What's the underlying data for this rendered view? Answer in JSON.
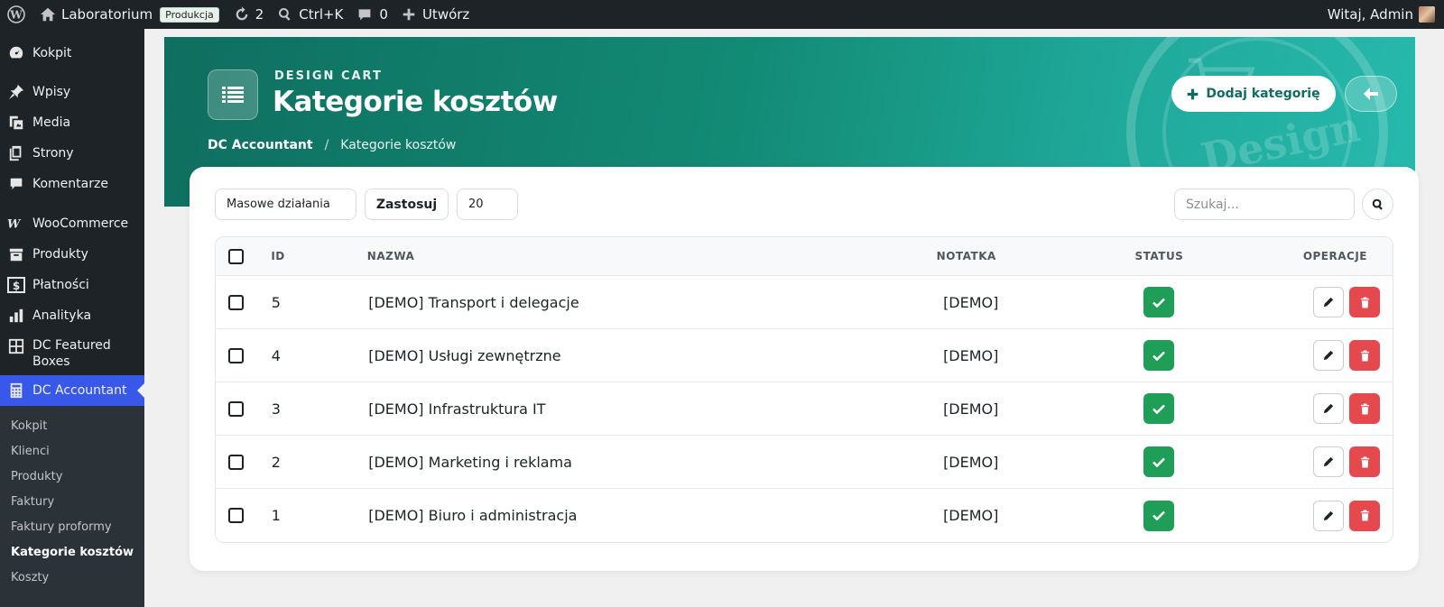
{
  "adminbar": {
    "site_name": "Laboratorium",
    "env_badge": "Produkcja",
    "updates_count": "2",
    "command_shortcut": "Ctrl+K",
    "comments_count": "0",
    "new_label": "Utwórz",
    "greeting": "Witaj, Admin"
  },
  "sidebar": {
    "items": [
      {
        "label": "Kokpit",
        "icon": "dashboard-icon"
      },
      {
        "label": "Wpisy",
        "icon": "pin-icon"
      },
      {
        "label": "Media",
        "icon": "media-icon"
      },
      {
        "label": "Strony",
        "icon": "pages-icon"
      },
      {
        "label": "Komentarze",
        "icon": "comment-icon"
      },
      {
        "label": "WooCommerce",
        "icon": "woocommerce-icon"
      },
      {
        "label": "Produkty",
        "icon": "archive-icon"
      },
      {
        "label": "Płatności",
        "icon": "dollar-icon"
      },
      {
        "label": "Analityka",
        "icon": "bar-chart-icon"
      },
      {
        "label": "DC Featured Boxes",
        "icon": "grid-icon"
      },
      {
        "label": "DC Accountant",
        "icon": "calculator-icon"
      }
    ],
    "submenu": [
      "Kokpit",
      "Klienci",
      "Produkty",
      "Faktury",
      "Faktury proformy",
      "Kategorie kosztów",
      "Koszty"
    ],
    "current_submenu": "Kategorie kosztów"
  },
  "hero": {
    "kicker": "DESIGN CART",
    "title": "Kategorie kosztów",
    "breadcrumb": [
      "DC Accountant",
      "Kategorie kosztów"
    ],
    "add_button": "Dodaj kategorię",
    "watermark_text": "Design",
    "accent": "#0f6e5f"
  },
  "toolbar": {
    "bulk_actions": "Masowe działania",
    "apply": "Zastosuj",
    "per_page": "20",
    "search_placeholder": "Szukaj..."
  },
  "table": {
    "headers": {
      "id": "ID",
      "name": "NAZWA",
      "note": "NOTATKA",
      "status": "STATUS",
      "ops": "OPERACJE"
    },
    "rows": [
      {
        "id": "5",
        "name": "[DEMO] Transport i delegacje",
        "note": "[DEMO]",
        "status": "active"
      },
      {
        "id": "4",
        "name": "[DEMO] Usługi zewnętrzne",
        "note": "[DEMO]",
        "status": "active"
      },
      {
        "id": "3",
        "name": "[DEMO] Infrastruktura IT",
        "note": "[DEMO]",
        "status": "active"
      },
      {
        "id": "2",
        "name": "[DEMO] Marketing i reklama",
        "note": "[DEMO]",
        "status": "active"
      },
      {
        "id": "1",
        "name": "[DEMO] Biuro i administracja",
        "note": "[DEMO]",
        "status": "active"
      }
    ]
  },
  "colors": {
    "status_ok": "#1e9e57",
    "delete": "#e5484d",
    "menu_active": "#3858e9"
  }
}
